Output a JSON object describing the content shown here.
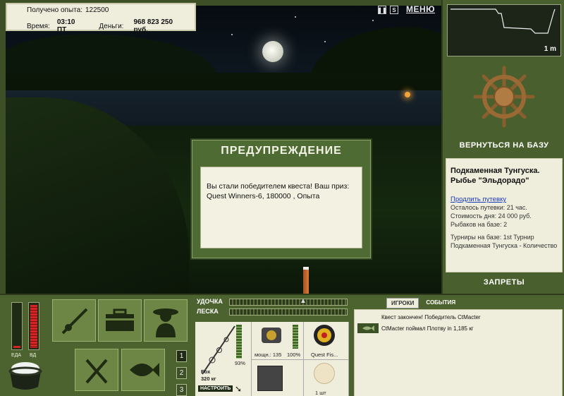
{
  "stats": {
    "exp_label": "Получено опыта:",
    "exp_value": "122500",
    "time_label": "Время:",
    "time_value": "03:10 ПТ",
    "money_label": "Деньги:",
    "money_value": "968 823 250 руб."
  },
  "top": {
    "pause_icon": "pause-icon",
    "sound_label": "S",
    "menu_label": "МЕНЮ"
  },
  "minimap": {
    "scale_label": "1 m"
  },
  "right": {
    "return_label": "ВЕРНУТЬСЯ НА БАЗУ",
    "location": "Подкаменная Тунгуска. Рыбье \"Эльдорадо\"",
    "extend_link": "Продлить путевку",
    "remaining": "Осталось путевки: 21 час.",
    "day_cost": "Стоимость дня: 24 000 руб.",
    "anglers": "Рыбаков на базе: 2",
    "tournaments": "Турниры на базе: 1st Турнир Подкаменная Тунгуска - Количество",
    "bans_label": "ЗАПРЕТЫ"
  },
  "dialog": {
    "title": "ПРЕДУПРЕЖДЕНИЕ",
    "message": "Вы стали победителем квеста! Ваш приз: Quest Winners-6, 180000 , Опыта"
  },
  "meters": {
    "food_label": "ЕДА",
    "food_level": 0.05,
    "drink_label": "ВД",
    "drink_level": 0.95
  },
  "pages": [
    "1",
    "2",
    "3"
  ],
  "gear": {
    "rod_label": "УДОЧКА",
    "line_label": "ЛЕСКА",
    "rod_percent": "93%",
    "rod_name": "Fox",
    "rod_weight": "320 кг",
    "setup_label": "НАСТРОИТЬ",
    "reel_power": "мощн.: 135",
    "reel_percent": "100%",
    "line_name": "Quest Fis...",
    "bait_qty": "1 шт"
  },
  "chat": {
    "tabs": [
      "ИГРОКИ",
      "СОБЫТИЯ"
    ],
    "active_tab": 0,
    "msg1": "Квест закончен! Победитель CtMacter",
    "msg2": "CtMacter поймал Плотву in 1,185 кг"
  },
  "colors": {
    "panel_green": "#4c6330",
    "cream": "#efeedd",
    "accent_red": "#d42424"
  }
}
